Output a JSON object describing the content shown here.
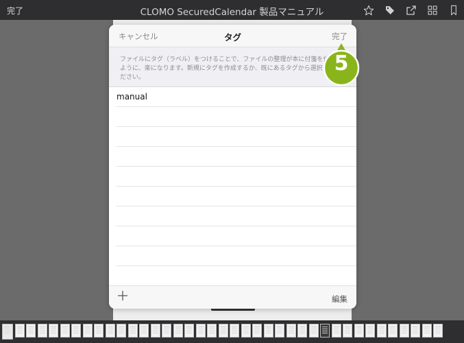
{
  "topbar": {
    "done_label": "完了",
    "title": "CLOMO SecuredCalendar 製品マニュアル",
    "icons": [
      "star-icon",
      "tag-icon",
      "share-icon",
      "grid-icon",
      "bookmark-icon"
    ]
  },
  "modal": {
    "cancel_label": "キャンセル",
    "title": "タグ",
    "done_label": "完了",
    "description": "ファイルにタグ（ラベル）をつけることで、ファイルの整理が本に付箋を付けるように、楽になります。新規にタグを作成するか、既にあるタグから選択してください。",
    "tags": [
      "manual"
    ],
    "edit_label": "編集"
  },
  "callout": {
    "step": "5",
    "color": "#8ab51a"
  },
  "colors": {
    "bar_bg": "#2e2e30",
    "backdrop": "#6b6b6b",
    "accent_green": "#8ab51a"
  }
}
